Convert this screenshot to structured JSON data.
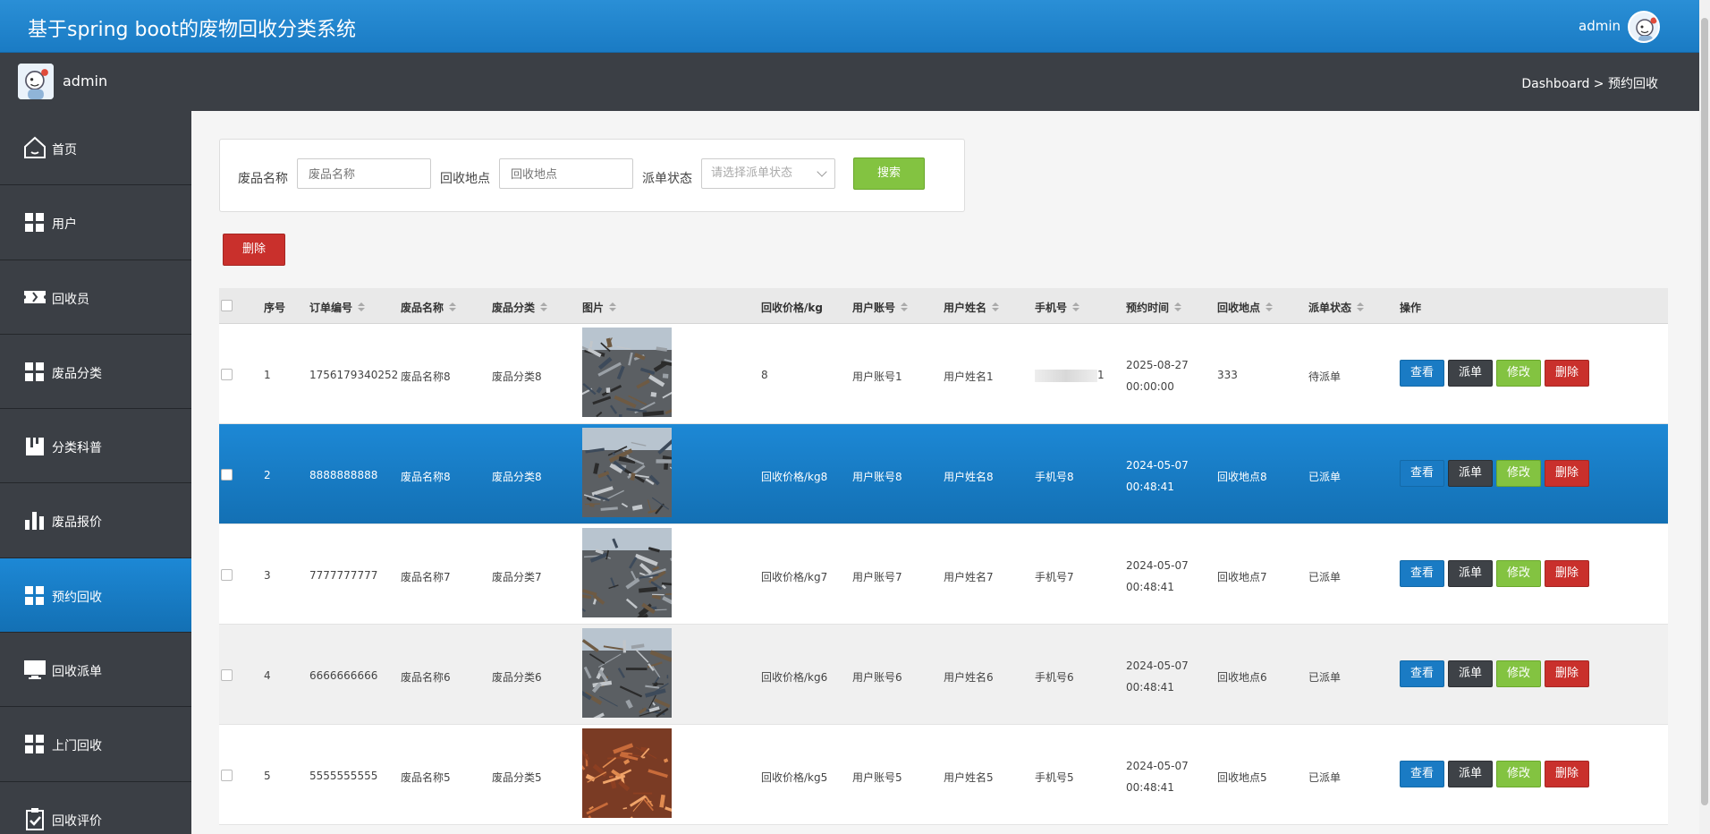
{
  "header": {
    "title": "基于spring boot的废物回收分类系统",
    "user": "admin"
  },
  "subbar": {
    "name": "admin",
    "breadcrumb": "Dashboard > 预约回收"
  },
  "sidebar": {
    "items": [
      {
        "label": "首页",
        "icon": "home-icon"
      },
      {
        "label": "用户",
        "icon": "grid-icon"
      },
      {
        "label": "回收员",
        "icon": "ticket-icon"
      },
      {
        "label": "废品分类",
        "icon": "grid-icon"
      },
      {
        "label": "分类科普",
        "icon": "book-icon"
      },
      {
        "label": "废品报价",
        "icon": "bar-chart-icon"
      },
      {
        "label": "预约回收",
        "icon": "grid-icon"
      },
      {
        "label": "回收派单",
        "icon": "monitor-icon"
      },
      {
        "label": "上门回收",
        "icon": "grid-icon"
      },
      {
        "label": "回收评价",
        "icon": "clipboard-check-icon"
      }
    ],
    "active_index": 6
  },
  "search": {
    "name_label": "废品名称",
    "name_placeholder": "废品名称",
    "location_label": "回收地点",
    "location_placeholder": "回收地点",
    "status_label": "派单状态",
    "status_placeholder": "请选择派单状态",
    "search_button": "搜索"
  },
  "toolbar": {
    "delete_button": "删除"
  },
  "table": {
    "headers": {
      "index": "序号",
      "order_no": "订单编号",
      "waste_name": "废品名称",
      "waste_category": "废品分类",
      "image": "图片",
      "price": "回收价格/kg",
      "account": "用户账号",
      "username": "用户姓名",
      "phone": "手机号",
      "time": "预约时间",
      "location": "回收地点",
      "status": "派单状态",
      "actions": "操作"
    },
    "actions": {
      "view": "查看",
      "dispatch": "派单",
      "edit": "修改",
      "delete": "删除"
    },
    "rows": [
      {
        "index": "1",
        "order_no": "1756179340252",
        "waste_name": "废品名称8",
        "waste_category": "废品分类8",
        "price": "8",
        "account": "用户账号1",
        "username": "用户姓名1",
        "phone": "1",
        "time": "2025-08-27 00:00:00",
        "location": "333",
        "status": "待派单"
      },
      {
        "index": "2",
        "order_no": "8888888888",
        "waste_name": "废品名称8",
        "waste_category": "废品分类8",
        "price": "回收价格/kg8",
        "account": "用户账号8",
        "username": "用户姓名8",
        "phone": "手机号8",
        "time": "2024-05-07 00:48:41",
        "location": "回收地点8",
        "status": "已派单"
      },
      {
        "index": "3",
        "order_no": "7777777777",
        "waste_name": "废品名称7",
        "waste_category": "废品分类7",
        "price": "回收价格/kg7",
        "account": "用户账号7",
        "username": "用户姓名7",
        "phone": "手机号7",
        "time": "2024-05-07 00:48:41",
        "location": "回收地点7",
        "status": "已派单"
      },
      {
        "index": "4",
        "order_no": "6666666666",
        "waste_name": "废品名称6",
        "waste_category": "废品分类6",
        "price": "回收价格/kg6",
        "account": "用户账号6",
        "username": "用户姓名6",
        "phone": "手机号6",
        "time": "2024-05-07 00:48:41",
        "location": "回收地点6",
        "status": "已派单"
      },
      {
        "index": "5",
        "order_no": "5555555555",
        "waste_name": "废品名称5",
        "waste_category": "废品分类5",
        "price": "回收价格/kg5",
        "account": "用户账号5",
        "username": "用户姓名5",
        "phone": "手机号5",
        "time": "2024-05-07 00:48:41",
        "location": "回收地点5",
        "status": "已派单"
      }
    ]
  }
}
